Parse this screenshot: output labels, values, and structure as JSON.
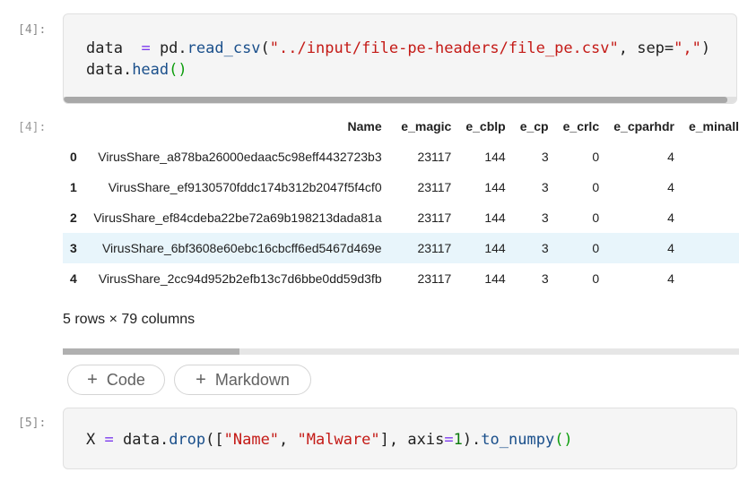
{
  "cell4": {
    "prompt": "[4]:",
    "output_prompt": "[4]:",
    "line1": {
      "var": "data",
      "spaces": "  ",
      "eq": "=",
      "mod": "pd.",
      "fn": "read_csv",
      "paren_open": "(",
      "str": "\"../input/file-pe-headers/file_pe.csv\"",
      "comma": ", sep=",
      "sep": "\",\"",
      "paren_close": ")"
    },
    "line2": {
      "var": "data.",
      "fn": "head",
      "parens": "()"
    }
  },
  "table": {
    "columns": [
      "Name",
      "e_magic",
      "e_cblp",
      "e_cp",
      "e_crlc",
      "e_cparhdr",
      "e_minall"
    ],
    "rows": [
      {
        "idx": "0",
        "name": "VirusShare_a878ba26000edaac5c98eff4432723b3",
        "e_magic": "23117",
        "e_cblp": "144",
        "e_cp": "3",
        "e_crlc": "0",
        "e_cparhdr": "4"
      },
      {
        "idx": "1",
        "name": "VirusShare_ef9130570fddc174b312b2047f5f4cf0",
        "e_magic": "23117",
        "e_cblp": "144",
        "e_cp": "3",
        "e_crlc": "0",
        "e_cparhdr": "4"
      },
      {
        "idx": "2",
        "name": "VirusShare_ef84cdeba22be72a69b198213dada81a",
        "e_magic": "23117",
        "e_cblp": "144",
        "e_cp": "3",
        "e_crlc": "0",
        "e_cparhdr": "4"
      },
      {
        "idx": "3",
        "name": "VirusShare_6bf3608e60ebc16cbcff6ed5467d469e",
        "e_magic": "23117",
        "e_cblp": "144",
        "e_cp": "3",
        "e_crlc": "0",
        "e_cparhdr": "4"
      },
      {
        "idx": "4",
        "name": "VirusShare_2cc94d952b2efb13c7d6bbe0dd59d3fb",
        "e_magic": "23117",
        "e_cblp": "144",
        "e_cp": "3",
        "e_crlc": "0",
        "e_cparhdr": "4"
      }
    ],
    "summary": "5 rows × 79 columns"
  },
  "buttons": {
    "code_label": "Code",
    "markdown_label": "Markdown",
    "plus": "+"
  },
  "cell5": {
    "prompt": "[5]:",
    "var": "X",
    "eq": "=",
    "obj": "data.",
    "fn": "drop",
    "open": "([",
    "str1": "\"Name\"",
    "comma1": ", ",
    "str2": "\"Malware\"",
    "close1": "], axis",
    "eq2": "=",
    "num": "1",
    "close2": ").",
    "fn2": "to_numpy",
    "parens": "()"
  },
  "colors": {
    "code_bg": "#f5f5f5",
    "highlight_row": "#e8f5fb",
    "string": "#c41a16",
    "function": "#1a4f8b"
  }
}
